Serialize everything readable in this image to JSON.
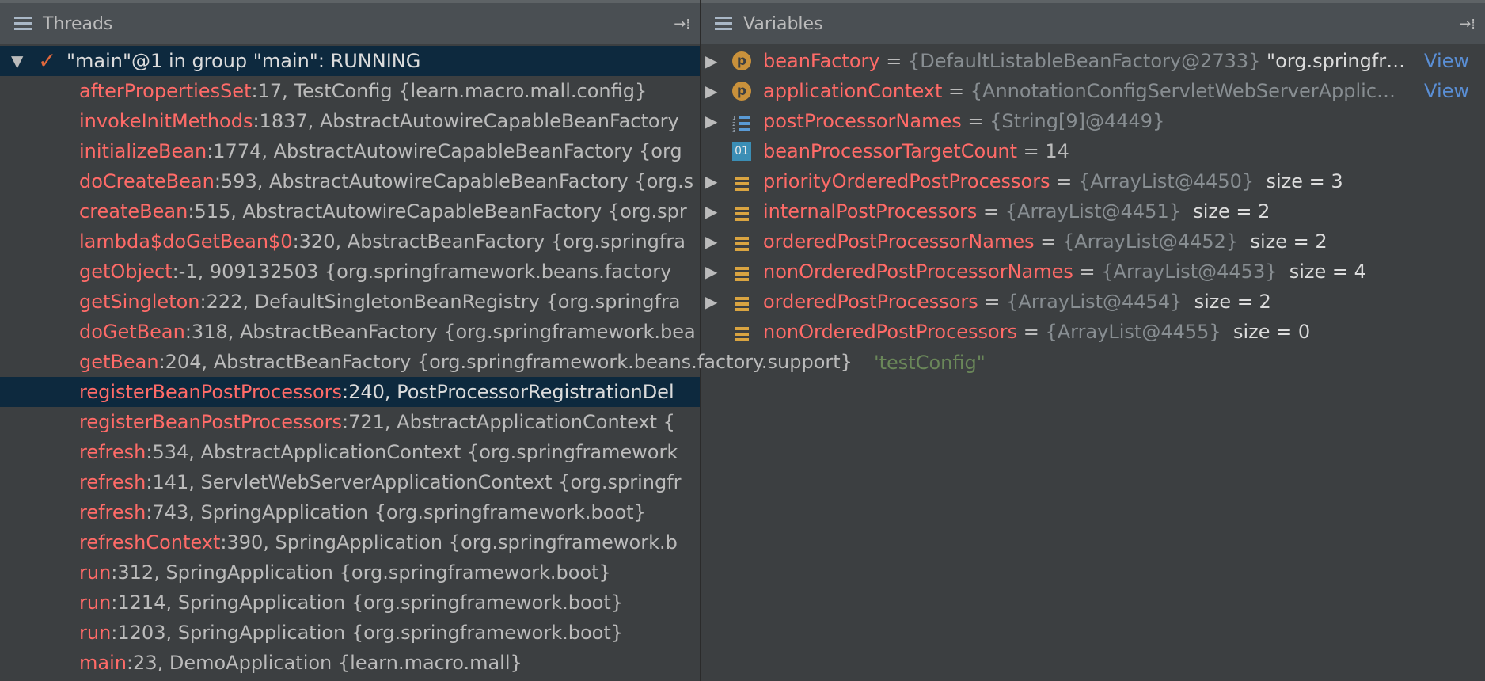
{
  "threads_panel": {
    "title": "Threads",
    "thread": {
      "label": "\"main\"@1 in group \"main\": RUNNING"
    },
    "frames": [
      {
        "method": "afterPropertiesSet",
        "rest": ":17, TestConfig {learn.macro.mall.config}"
      },
      {
        "method": "invokeInitMethods",
        "rest": ":1837, AbstractAutowireCapableBeanFactory"
      },
      {
        "method": "initializeBean",
        "rest": ":1774, AbstractAutowireCapableBeanFactory {org"
      },
      {
        "method": "doCreateBean",
        "rest": ":593, AbstractAutowireCapableBeanFactory {org.s"
      },
      {
        "method": "createBean",
        "rest": ":515, AbstractAutowireCapableBeanFactory {org.spr"
      },
      {
        "method": "lambda$doGetBean$0",
        "rest": ":320, AbstractBeanFactory {org.springfra"
      },
      {
        "method": "getObject",
        "rest": ":-1, 909132503 {org.springframework.beans.factory"
      },
      {
        "method": "getSingleton",
        "rest": ":222, DefaultSingletonBeanRegistry {org.springfra"
      },
      {
        "method": "doGetBean",
        "rest": ":318, AbstractBeanFactory {org.springframework.bea"
      },
      {
        "method": "getBean",
        "rest": ":204, AbstractBeanFactory {org.springframework.beans.factory.support}"
      },
      {
        "method": "registerBeanPostProcessors",
        "rest": ":240, PostProcessorRegistrationDel"
      },
      {
        "method": "registerBeanPostProcessors",
        "rest": ":721, AbstractApplicationContext {"
      },
      {
        "method": "refresh",
        "rest": ":534, AbstractApplicationContext {org.springframework"
      },
      {
        "method": "refresh",
        "rest": ":141, ServletWebServerApplicationContext {org.springfr"
      },
      {
        "method": "refresh",
        "rest": ":743, SpringApplication {org.springframework.boot}"
      },
      {
        "method": "refreshContext",
        "rest": ":390, SpringApplication {org.springframework.b"
      },
      {
        "method": "run",
        "rest": ":312, SpringApplication {org.springframework.boot}"
      },
      {
        "method": "run",
        "rest": ":1214, SpringApplication {org.springframework.boot}"
      },
      {
        "method": "run",
        "rest": ":1203, SpringApplication {org.springframework.boot}"
      },
      {
        "method": "main",
        "rest": ":23, DemoApplication {learn.macro.mall}"
      }
    ],
    "tooltip_tail": "'testConfig\""
  },
  "variables_panel": {
    "title": "Variables",
    "variables": [
      {
        "icon": "p-field-icon",
        "name": "beanFactory",
        "op": " = ",
        "type": "{DefaultListableBeanFactory@2733}",
        "extra": " \"org.springfr…",
        "link": "View"
      },
      {
        "icon": "p-field-icon",
        "name": "applicationContext",
        "op": " = ",
        "type": "{AnnotationConfigServletWebServerApplic…",
        "extra": "",
        "link": "View"
      },
      {
        "icon": "array-icon",
        "name": "postProcessorNames",
        "op": " = ",
        "type": "{String[9]@4449}",
        "extra": "",
        "link": ""
      },
      {
        "icon": "primitive-icon",
        "name": "beanProcessorTargetCount",
        "op": " = 14",
        "type": "",
        "extra": "",
        "link": ""
      },
      {
        "icon": "list-icon",
        "name": "priorityOrderedPostProcessors",
        "op": " = ",
        "type": "{ArrayList@4450}",
        "extra": "  size = 3",
        "link": ""
      },
      {
        "icon": "list-icon",
        "name": "internalPostProcessors",
        "op": " = ",
        "type": "{ArrayList@4451}",
        "extra": "  size = 2",
        "link": ""
      },
      {
        "icon": "list-icon",
        "name": "orderedPostProcessorNames",
        "op": " = ",
        "type": "{ArrayList@4452}",
        "extra": "  size = 2",
        "link": ""
      },
      {
        "icon": "list-icon",
        "name": "nonOrderedPostProcessorNames",
        "op": " = ",
        "type": "{ArrayList@4453}",
        "extra": "  size = 4",
        "link": ""
      },
      {
        "icon": "list-icon",
        "name": "orderedPostProcessors",
        "op": " = ",
        "type": "{ArrayList@4454}",
        "extra": "  size = 2",
        "link": ""
      },
      {
        "icon": "list-icon",
        "name": "nonOrderedPostProcessors",
        "op": " = ",
        "type": "{ArrayList@4455}",
        "extra": "  size = 0",
        "link": ""
      }
    ],
    "icon_labels": {
      "p": "p",
      "primitive": "01",
      "array_digits": "1\n2\n3"
    }
  }
}
